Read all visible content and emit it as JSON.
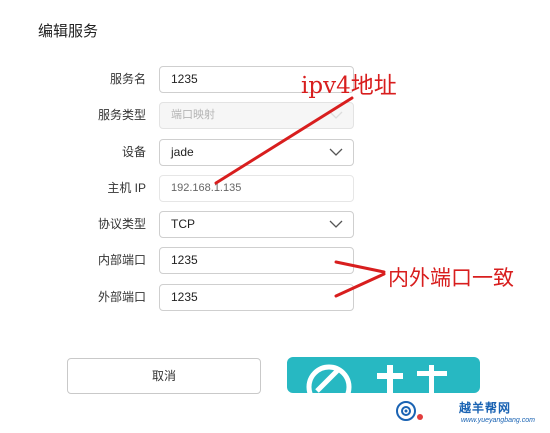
{
  "dialog": {
    "title": "编辑服务"
  },
  "form": {
    "service_name": {
      "label": "服务名",
      "value": "1235"
    },
    "service_type": {
      "label": "服务类型",
      "value": "端口映射"
    },
    "device": {
      "label": "设备",
      "value": "jade"
    },
    "host_ip": {
      "label": "主机 IP",
      "value": "192.168.1.135"
    },
    "protocol": {
      "label": "协议类型",
      "value": "TCP"
    },
    "internal_port": {
      "label": "内部端口",
      "value": "1235"
    },
    "external_port": {
      "label": "外部端口",
      "value": "1235"
    }
  },
  "buttons": {
    "cancel": "取消",
    "save_icon": "router-logo-icon"
  },
  "annotations": {
    "ipv4": "ipv4地址",
    "ports": "内外端口一致",
    "color": "#d81e1e"
  },
  "watermark": {
    "text": "越羊帮网",
    "url": "www.yueyangbang.com"
  },
  "colors": {
    "accent": "#27b8c2",
    "border": "#cfcfcf"
  }
}
